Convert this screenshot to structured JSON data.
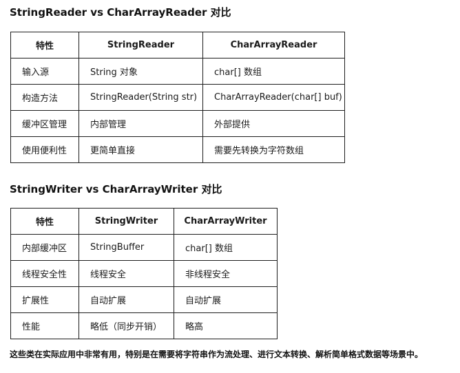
{
  "section1": {
    "title": "StringReader vs CharArrayReader 对比",
    "headers": [
      "特性",
      "StringReader",
      "CharArrayReader"
    ],
    "rows": [
      [
        "输入源",
        "String 对象",
        "char[] 数组"
      ],
      [
        "构造方法",
        "StringReader(String str)",
        "CharArrayReader(char[] buf)"
      ],
      [
        "缓冲区管理",
        "内部管理",
        "外部提供"
      ],
      [
        "使用便利性",
        "更简单直接",
        "需要先转换为字符数组"
      ]
    ]
  },
  "section2": {
    "title": "StringWriter vs CharArrayWriter 对比",
    "headers": [
      "特性",
      "StringWriter",
      "CharArrayWriter"
    ],
    "rows": [
      [
        "内部缓冲区",
        "StringBuffer",
        "char[] 数组"
      ],
      [
        "线程安全性",
        "线程安全",
        "非线程安全"
      ],
      [
        "扩展性",
        "自动扩展",
        "自动扩展"
      ],
      [
        "性能",
        "略低（同步开销）",
        "略高"
      ]
    ]
  },
  "note": "这些类在实际应用中非常有用，特别是在需要将字符串作为流处理、进行文本转换、解析简单格式数据等场景中。"
}
